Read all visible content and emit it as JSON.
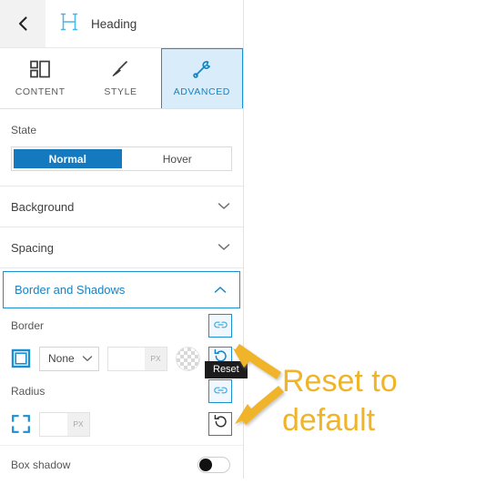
{
  "header": {
    "back_icon": "chevron-left-icon",
    "widget_icon": "heading-h-icon",
    "title": "Heading"
  },
  "tabs": [
    {
      "label": "CONTENT",
      "icon": "layout-blocks-icon",
      "active": false
    },
    {
      "label": "STYLE",
      "icon": "paintbrush-icon",
      "active": false
    },
    {
      "label": "ADVANCED",
      "icon": "wrench-icon",
      "active": true
    }
  ],
  "state": {
    "label": "State",
    "options": [
      "Normal",
      "Hover"
    ],
    "selected": "Normal"
  },
  "sections": [
    {
      "title": "Background",
      "open": false,
      "chevron": "chevron-down-icon"
    },
    {
      "title": "Spacing",
      "open": false,
      "chevron": "chevron-down-icon"
    },
    {
      "title": "Border and Shadows",
      "open": true,
      "chevron": "chevron-up-icon"
    }
  ],
  "border": {
    "label": "Border",
    "responsive_icon": "link-responsive-icon",
    "type_icon": "square-outline-icon",
    "style_value": "None",
    "style_chevron": "chevron-down-icon",
    "width_value": "",
    "width_unit": "PX",
    "color_swatch": "transparent-checker-swatch",
    "reset_icon": "reset-undo-icon"
  },
  "radius": {
    "label": "Radius",
    "responsive_icon": "link-responsive-icon",
    "type_icon": "corners-outline-icon",
    "value": "",
    "unit": "PX",
    "reset_icon": "reset-undo-icon"
  },
  "box_shadow": {
    "label": "Box shadow",
    "toggle_state": "off"
  },
  "tooltip": {
    "text": "Reset"
  },
  "annotation": {
    "line1": "Reset to",
    "line2": "default",
    "color": "#f0b429",
    "arrow_count": 2
  },
  "colors": {
    "accent_blue": "#1a8fd1",
    "active_tab_bg": "#d8ecf9",
    "selected_blue": "#1579bf",
    "annotation_yellow": "#f0b429",
    "tooltip_bg": "#1c1c1c"
  }
}
